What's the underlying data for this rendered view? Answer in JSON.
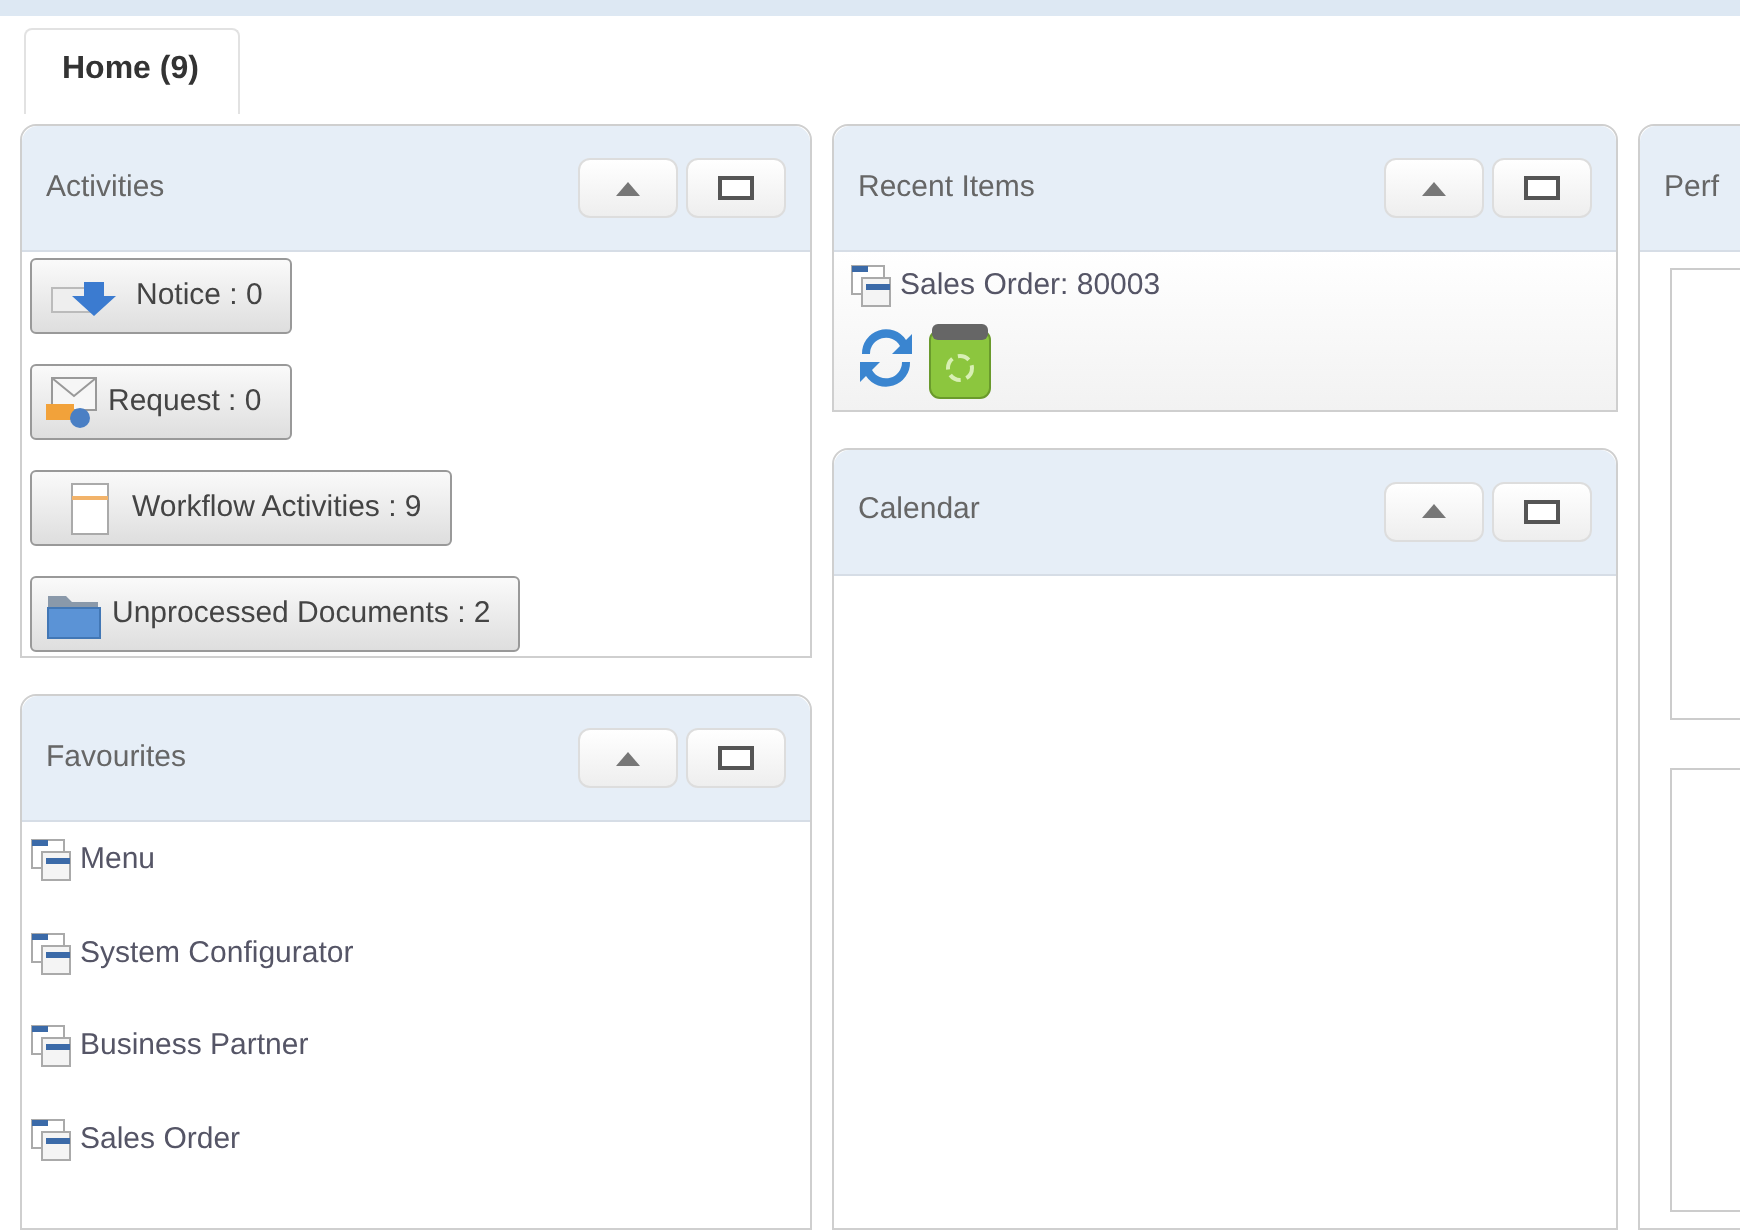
{
  "tabs": [
    {
      "label": "Home (9)",
      "selected": true
    }
  ],
  "columns": [
    {
      "panels": [
        {
          "kind": "activities",
          "title": "Activities",
          "buttons": [
            {
              "label": "Notice : 0",
              "kind": "notice"
            },
            {
              "label": "Request : 0",
              "kind": "request"
            },
            {
              "label": "Workflow Activities : 9",
              "kind": "workflow"
            },
            {
              "label": "Unprocessed Documents : 2",
              "kind": "documents"
            }
          ]
        },
        {
          "kind": "links",
          "title": "Favourites",
          "items": [
            "Menu",
            "System Configurator",
            "Business Partner",
            "Sales Order"
          ]
        }
      ]
    },
    {
      "panels": [
        {
          "kind": "recent",
          "title": "Recent Items",
          "items": [
            "Sales Order: 80003"
          ]
        },
        {
          "kind": "empty",
          "title": "Calendar"
        }
      ]
    },
    {
      "panels": [
        {
          "kind": "boxes",
          "title": "Perf"
        }
      ]
    }
  ]
}
